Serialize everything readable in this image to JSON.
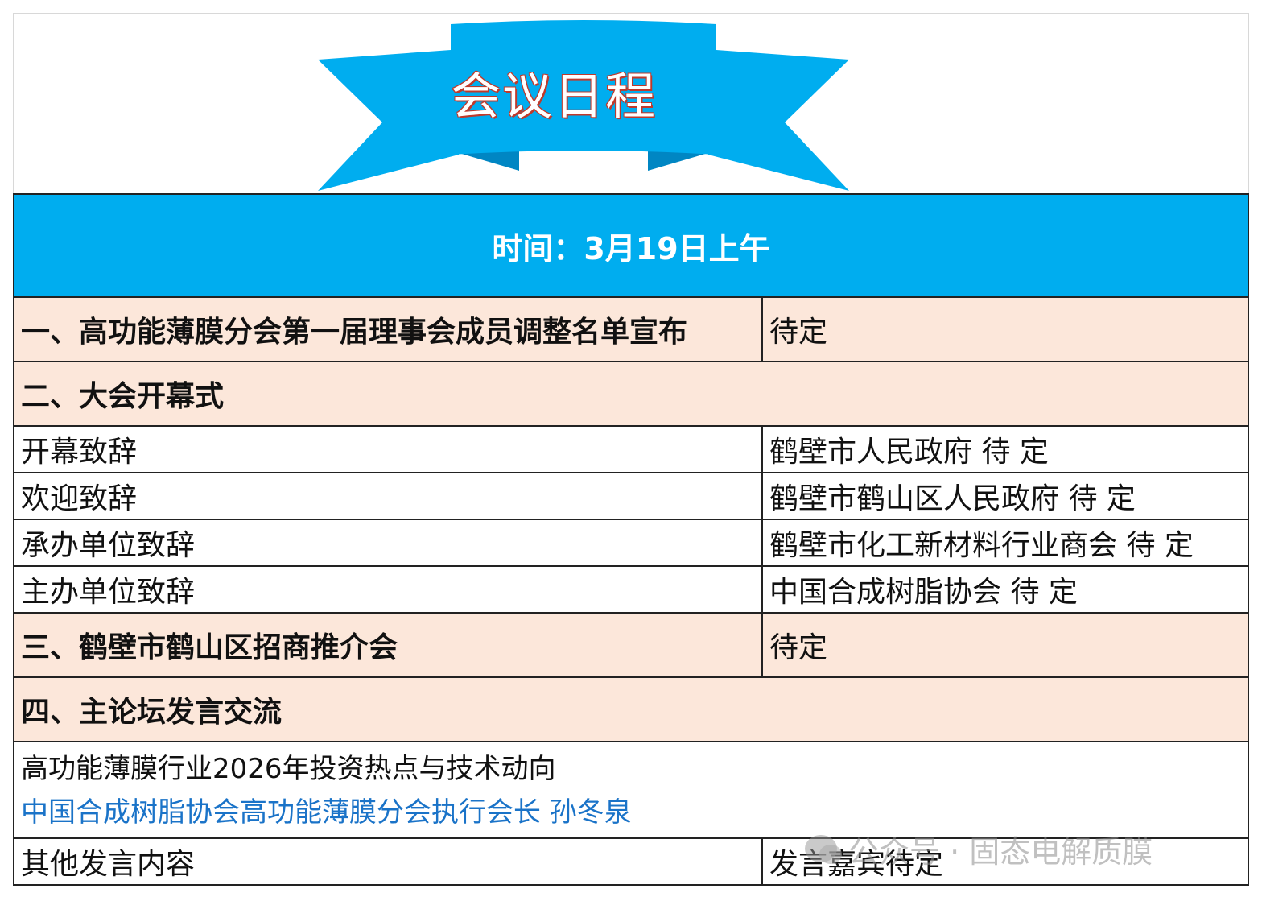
{
  "banner": {
    "title": "会议日程",
    "color": "#00adef",
    "title_outline": "#c0392b"
  },
  "session": {
    "time_label": "时间：3月19日上午"
  },
  "rows": [
    {
      "kind": "section",
      "left": "一、高功能薄膜分会第一届理事会成员调整名单宣布",
      "right": "待定"
    },
    {
      "kind": "section-full",
      "left": "二、大会开幕式"
    },
    {
      "kind": "item",
      "left": "开幕致辞",
      "right": "鹤壁市人民政府  待  定"
    },
    {
      "kind": "item",
      "left": "欢迎致辞",
      "right": "鹤壁市鹤山区人民政府 待  定"
    },
    {
      "kind": "item",
      "left": "承办单位致辞",
      "right": "鹤壁市化工新材料行业商会 待 定"
    },
    {
      "kind": "item",
      "left": "主办单位致辞",
      "right": "中国合成树脂协会  待  定"
    },
    {
      "kind": "section",
      "left": "三、鹤壁市鹤山区招商推介会",
      "right": "待定"
    },
    {
      "kind": "section-full",
      "left": "四、主论坛发言交流"
    }
  ],
  "talk": {
    "topic": "高功能薄膜行业2026年投资热点与技术动向",
    "speaker": "中国合成树脂协会高功能薄膜分会执行会长  孙冬泉"
  },
  "other": {
    "left": "其他发言内容",
    "right": "发言嘉宾待定"
  },
  "watermark": {
    "text": "公众号 · 固态电解质膜"
  },
  "colors": {
    "header_bg": "#00adef",
    "section_bg": "#fce7da",
    "speaker_text": "#1a73c8"
  }
}
